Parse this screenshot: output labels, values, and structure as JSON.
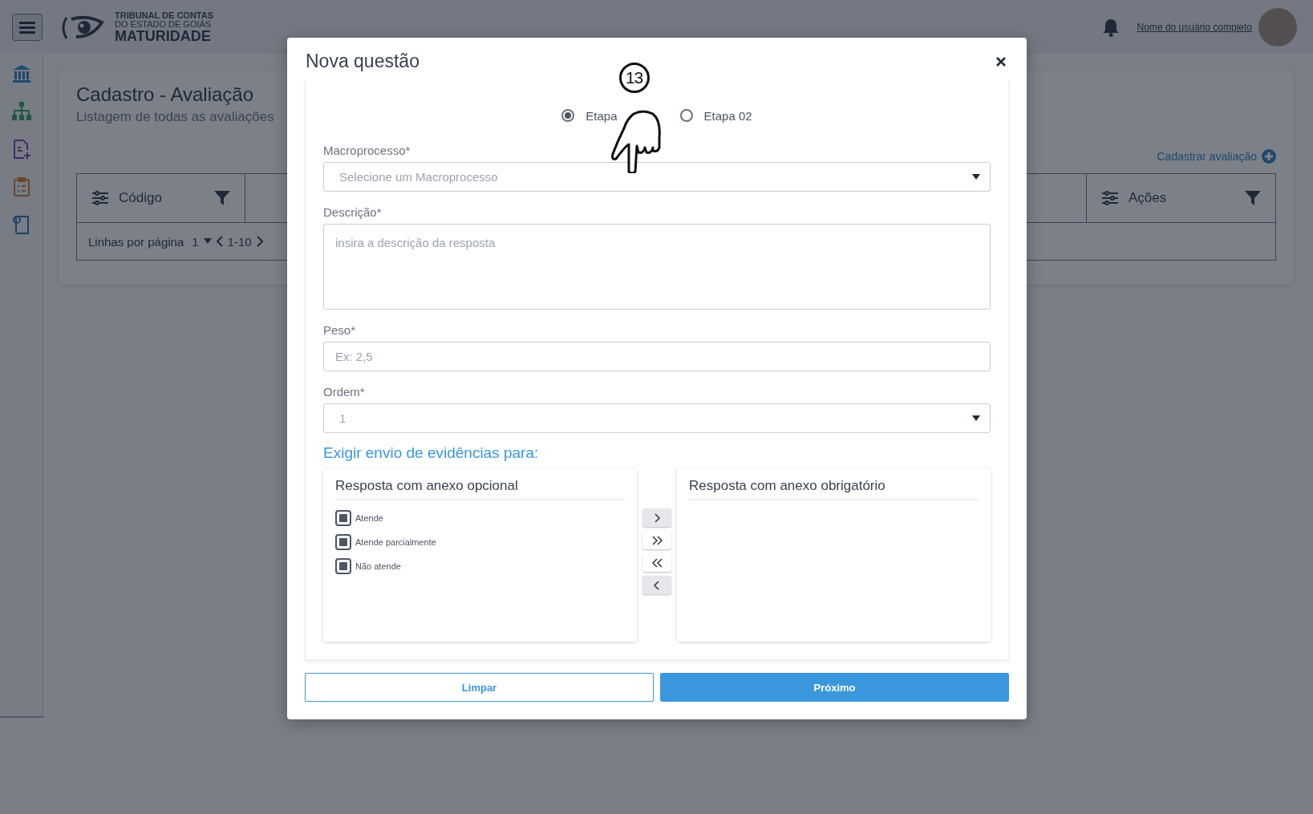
{
  "header": {
    "logo": {
      "line1": "TRIBUNAL DE CONTAS",
      "line2": "DO ESTADO DE GOIÁS",
      "line3": "MATURIDADE"
    },
    "user_name": "Nome do usuário completo"
  },
  "sidebar": {
    "items": [
      {
        "kind": "bank"
      },
      {
        "kind": "org"
      },
      {
        "kind": "file-plus"
      },
      {
        "kind": "clipboard"
      },
      {
        "kind": "document"
      }
    ]
  },
  "page": {
    "title": "Cadastro -  Avaliação",
    "subtitle": "Listagem de todas as avaliações",
    "add_link": "Cadastrar avaliação",
    "table": {
      "columns": [
        {
          "label": "Código"
        },
        {
          "label": "Ações"
        }
      ],
      "pagination": {
        "label": "Linhas por  página",
        "per_page": "1",
        "range": "1-10"
      }
    }
  },
  "modal": {
    "title": "Nova questão",
    "stages": [
      {
        "label": "Etapa",
        "selected": true
      },
      {
        "label": "Etapa 02",
        "selected": false
      }
    ],
    "fields": [
      {
        "kind": "select",
        "label": "Macroprocesso*",
        "placeholder": "Selecione um Macroprocesso"
      },
      {
        "kind": "textarea",
        "label": "Descrição*",
        "placeholder": "insira a descrição da resposta"
      },
      {
        "kind": "input",
        "label": "Peso*",
        "placeholder": "Ex: 2,5"
      },
      {
        "kind": "select",
        "label": "Ordem*",
        "value": "1"
      }
    ],
    "evidence": {
      "title": "Exigir envio de evidências para:",
      "optional": {
        "title": "Resposta com anexo opcional",
        "items": [
          {
            "label": "Atende",
            "checked": true
          },
          {
            "label": "Atende parcialmente",
            "checked": true
          },
          {
            "label": "Não atende",
            "checked": true
          }
        ]
      },
      "required": {
        "title": "Resposta com anexo obrigatório"
      },
      "moves": [
        {
          "kind": "right",
          "disabled": true
        },
        {
          "kind": "all-right",
          "disabled": false
        },
        {
          "kind": "all-left",
          "disabled": false
        },
        {
          "kind": "left",
          "disabled": true
        }
      ]
    },
    "buttons": [
      {
        "label": "Limpar",
        "kind": "secondary"
      },
      {
        "label": "Próximo",
        "kind": "primary"
      }
    ]
  },
  "step_marker": {
    "number": "13"
  }
}
